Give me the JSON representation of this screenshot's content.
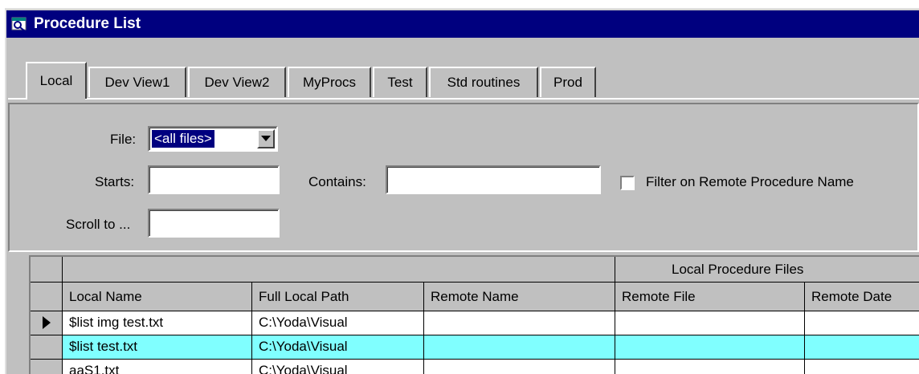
{
  "window": {
    "title": "Procedure List"
  },
  "tabs": [
    {
      "label": "Local",
      "active": true
    },
    {
      "label": "Dev View1"
    },
    {
      "label": "Dev View2"
    },
    {
      "label": "MyProcs"
    },
    {
      "label": "Test"
    },
    {
      "label": "Std routines"
    },
    {
      "label": "Prod"
    }
  ],
  "filter": {
    "file_label": "File:",
    "file_value": "<all files>",
    "starts_label": "Starts:",
    "starts_value": "",
    "contains_label": "Contains:",
    "contains_value": "",
    "scroll_label": "Scroll to ...",
    "scroll_value": "",
    "remote_filter_label": "Filter on Remote Procedure Name",
    "remote_filter_checked": false
  },
  "grid": {
    "group_header": "Local Procedure Files",
    "columns": [
      "Local Name",
      "Full Local Path",
      "Remote Name",
      "Remote File",
      "Remote Date"
    ],
    "rows": [
      {
        "local_name": "$list img test.txt",
        "path": "C:\\Yoda\\Visual",
        "remote_name": "",
        "remote_file": "",
        "remote_date": ""
      },
      {
        "local_name": "$list test.txt",
        "path": "C:\\Yoda\\Visual",
        "remote_name": "",
        "remote_file": "",
        "remote_date": ""
      },
      {
        "local_name": "aaS1.txt",
        "path": "C:\\Yoda\\Visual",
        "remote_name": "",
        "remote_file": "",
        "remote_date": ""
      }
    ],
    "current_row": 0,
    "selected_row": 1
  },
  "colors": {
    "titlebar": "#00007f",
    "face": "#c0c0c0",
    "selected_row": "#80ffff"
  }
}
